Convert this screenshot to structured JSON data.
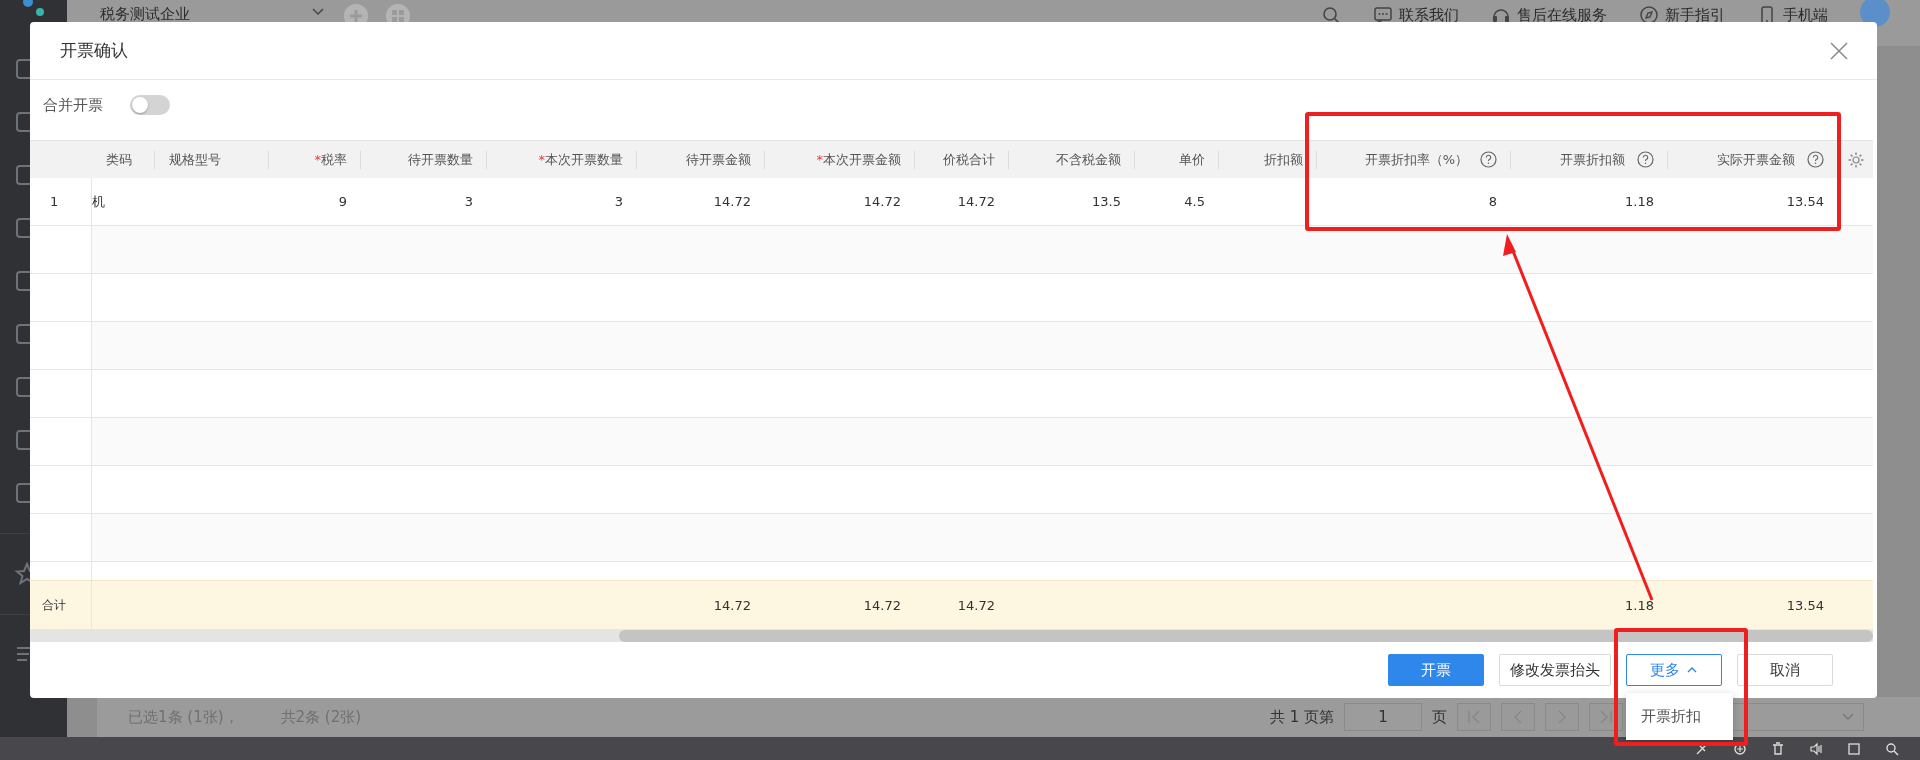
{
  "app_header": {
    "company": "税务测试企业",
    "links": [
      {
        "label": "联系我们",
        "kind": "chat"
      },
      {
        "label": "售后在线服务",
        "kind": "headset"
      },
      {
        "label": "新手指引",
        "kind": "compass"
      },
      {
        "label": "手机端",
        "kind": "phone"
      }
    ]
  },
  "dialog": {
    "title": "开票确认",
    "merge_toggle": {
      "label": "合并开票",
      "on": false
    },
    "table": {
      "columns": [
        {
          "label": "类码"
        },
        {
          "label": "规格型号"
        },
        {
          "label": "税率",
          "required_mark": "*"
        },
        {
          "label": "待开票数量"
        },
        {
          "label": "本次开票数量",
          "required_mark": "*"
        },
        {
          "label": "待开票金额"
        },
        {
          "label": "本次开票金额",
          "required_mark": "*"
        },
        {
          "label": "价税合计"
        },
        {
          "label": "不含税金额"
        },
        {
          "label": "单价"
        },
        {
          "label": "折扣额"
        },
        {
          "label": "开票折扣率（%）",
          "help": true
        },
        {
          "label": "开票折扣额",
          "help": true
        },
        {
          "label": "实际开票金额",
          "help": true
        }
      ],
      "rows": [
        {
          "index": "1",
          "cells": [
            "机",
            null,
            "9",
            "3",
            "3",
            "14.72",
            "14.72",
            "14.72",
            "13.5",
            "4.5",
            null,
            "8",
            "1.18",
            "13.54"
          ]
        }
      ],
      "totals": {
        "label": "合计",
        "cells": [
          null,
          null,
          null,
          null,
          null,
          "14.72",
          "14.72",
          "14.72",
          null,
          null,
          null,
          null,
          "1.18",
          "13.54"
        ]
      }
    },
    "buttons": [
      {
        "label": "开票",
        "kind": "primary"
      },
      {
        "label": "修改发票抬头",
        "kind": "default"
      },
      {
        "label": "更多",
        "kind": "dropdown",
        "expanded": true
      },
      {
        "label": "取消",
        "kind": "default"
      }
    ],
    "dropdown_menu": [
      {
        "label": "开票折扣"
      }
    ]
  },
  "page_behind": {
    "selection_summary": "已选1条 (1张)，",
    "total_summary": "共2条 (2张)",
    "pagination": {
      "prefix": "共 1 页第",
      "page": "1",
      "suffix": "页"
    }
  }
}
